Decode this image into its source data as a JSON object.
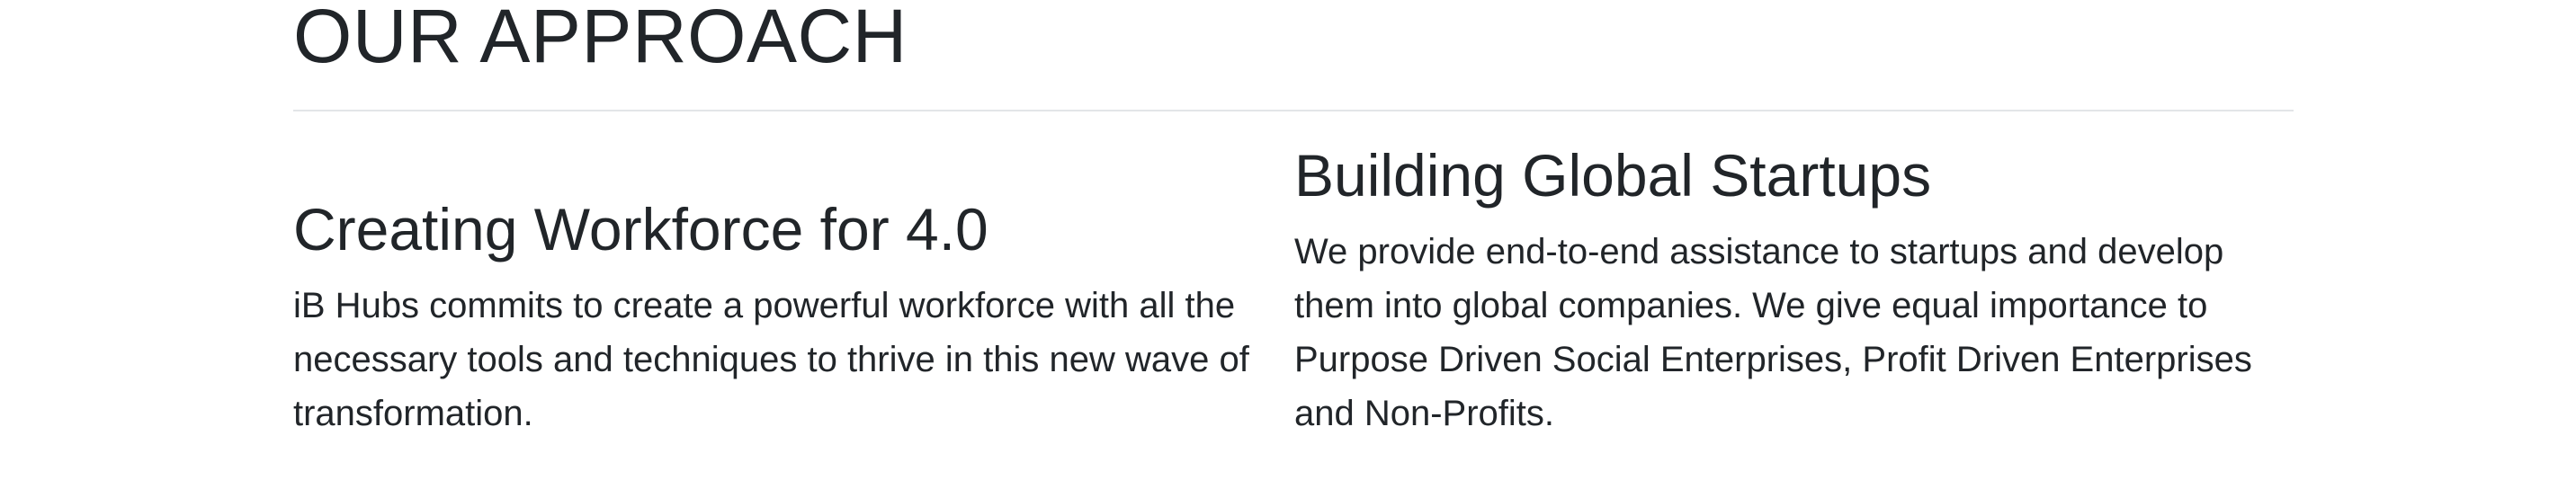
{
  "section": {
    "title": "OUR APPROACH"
  },
  "columns": [
    {
      "heading": "Creating Workforce for 4.0",
      "body": "iB Hubs commits to create a powerful workforce with all the necessary tools and techniques to thrive in this new wave of transformation."
    },
    {
      "heading": "Building Global Startups",
      "body": "We provide end-to-end assistance to startups and develop them into global companies. We give equal importance to Purpose Driven Social Enterprises, Profit Driven Enterprises and Non-Profits."
    }
  ]
}
